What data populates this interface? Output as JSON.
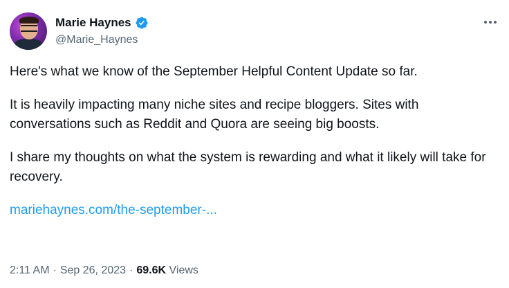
{
  "author": {
    "display_name": "Marie Haynes",
    "handle": "@Marie_Haynes",
    "verified": true,
    "verified_color": "#1d9bf0"
  },
  "tweet": {
    "paragraphs": [
      "Here's what we know of the September Helpful Content Update so far.",
      "It is heavily impacting many niche sites and recipe bloggers. Sites with conversations such as Reddit and Quora are seeing big boosts.",
      "I share my thoughts on what the system is rewarding and what it likely will take for recovery."
    ],
    "link_text": "mariehaynes.com/the-september-..."
  },
  "meta": {
    "time": "2:11 AM",
    "separator": "·",
    "date": "Sep 26, 2023",
    "views_count": "69.6K",
    "views_label": "Views"
  },
  "icons": {
    "more": "more-options-icon",
    "verified": "verified-badge-icon"
  },
  "colors": {
    "text": "#0f1419",
    "secondary": "#536471",
    "link": "#1d9bf0"
  }
}
